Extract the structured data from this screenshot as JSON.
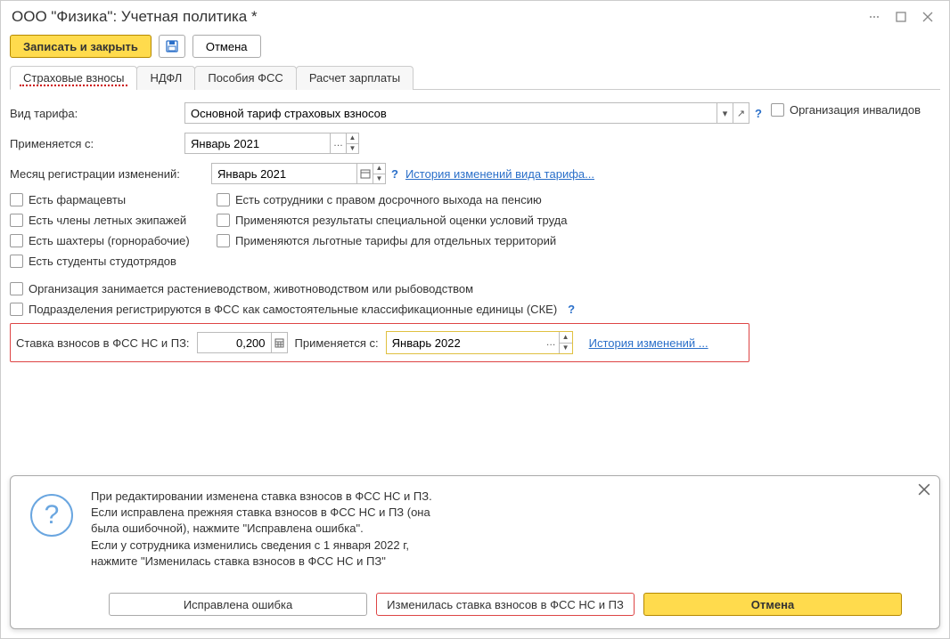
{
  "window": {
    "title": "ООО \"Физика\": Учетная политика *"
  },
  "toolbar": {
    "save_close": "Записать и закрыть",
    "cancel": "Отмена"
  },
  "tabs": {
    "t1": "Страховые взносы",
    "t2": "НДФЛ",
    "t3": "Пособия ФСС",
    "t4": "Расчет зарплаты"
  },
  "form": {
    "tariff_label": "Вид тарифа:",
    "tariff_value": "Основной тариф страховых взносов",
    "org_invalid": "Организация инвалидов",
    "applies_from_label": "Применяется с:",
    "applies_from_value": "Январь 2021",
    "month_reg_label": "Месяц регистрации изменений:",
    "month_reg_value": "Январь 2021",
    "history_link": "История изменений вида тарифа...",
    "chk_pharma": "Есть фармацевты",
    "chk_crew": "Есть члены летных экипажей",
    "chk_miners": "Есть шахтеры (горнорабочие)",
    "chk_students": "Есть студенты студотрядов",
    "chk_pension": "Есть сотрудники с правом досрочного выхода на пенсию",
    "chk_special": "Применяются результаты специальной оценки условий труда",
    "chk_territory": "Применяются льготные тарифы для отдельных территорий",
    "chk_agro": "Организация занимается растениеводством, животноводством или рыбоводством",
    "chk_ske": "Подразделения регистрируются в ФСС как самостоятельные классификационные единицы (СКЕ)",
    "rate_label": "Ставка взносов в ФСС НС и ПЗ:",
    "rate_value": "0,200",
    "rate_from_label": "Применяется с:",
    "rate_from_value": "Январь 2022",
    "history2": "История изменений ..."
  },
  "dialog": {
    "l1": "При редактировании изменена ставка взносов в ФСС НС и ПЗ.",
    "l2": "Если исправлена прежняя ставка взносов в ФСС НС и ПЗ (она",
    "l3": "была ошибочной), нажмите \"Исправлена ошибка\".",
    "l4": "Если у сотрудника изменились сведения с 1 января 2022 г,",
    "l5": "нажмите \"Изменилась ставка взносов в ФСС НС и ПЗ\"",
    "b1": "Исправлена ошибка",
    "b2": "Изменилась ставка взносов в ФСС НС и ПЗ",
    "b3": "Отмена"
  }
}
